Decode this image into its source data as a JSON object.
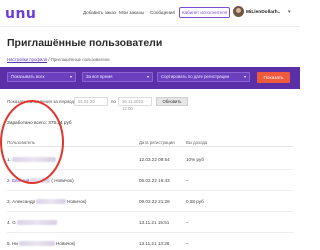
{
  "header": {
    "logo": "unu",
    "nav": [
      "Добавить заказ",
      "Мои заказы",
      "Сообщения"
    ],
    "cabinet_button": "Кабинет исполнителя",
    "username": "MiLlenDollarh..",
    "chevron": "▾"
  },
  "page_title": "Приглашённые пользователи",
  "breadcrumb": {
    "home": "Настройки профиля",
    "separator": "/",
    "current": "Приглашённые пользователи"
  },
  "filters": {
    "select1": "Показывать всех",
    "select2": "За всё время",
    "select3": "Сортировать по дате регистрации",
    "show_button": "Показать",
    "arrow": "▾"
  },
  "date_filter": {
    "label": "Показать начисления за период с",
    "from": "01.01.20",
    "to_label": "по",
    "to": "26.11.2022 12:00",
    "refresh_button": "Обновить"
  },
  "earned_total": "Заработано всего: 375.24 руб",
  "table": {
    "headers": [
      "Пользователь",
      "Дата регистрации",
      "Вы дохода"
    ],
    "rows": [
      {
        "prefix": "1.",
        "tag": "",
        "date": "12.03.22 09:54",
        "income": "10% руб",
        "link": false
      },
      {
        "prefix": "2. Евгений",
        "tag": "( Новичок)",
        "date": "05.02.22 16:43",
        "income": "–",
        "link": true
      },
      {
        "prefix": "3. Александр",
        "tag": "Новичок)",
        "date": "09.02.22 21:28",
        "income": "0.58 руб",
        "link": false
      },
      {
        "prefix": "4. G",
        "tag": "",
        "date": "13.11.21 15:51",
        "income": "–",
        "link": false
      },
      {
        "prefix": "5. Ни",
        "tag": "Новичок)",
        "date": "13.11.21 13:28",
        "income": "–",
        "link": false
      }
    ]
  },
  "colors": {
    "accent": "#5b2fa8",
    "button": "#ef5a3c",
    "annotation": "#e0362c"
  }
}
